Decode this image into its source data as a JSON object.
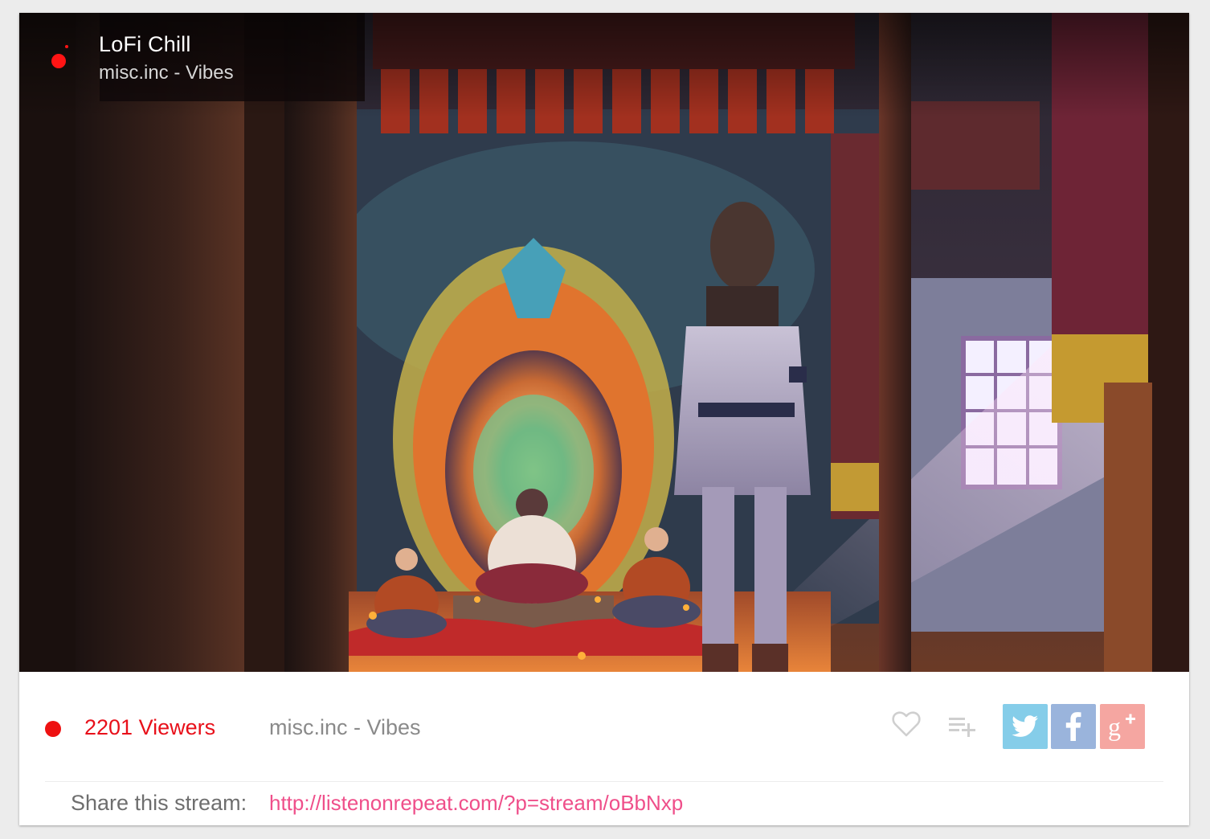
{
  "player": {
    "title": "LoFi Chill",
    "subtitle": "misc.inc - Vibes",
    "thumbnail_icon": "anime-temple-scene-image"
  },
  "info_bar": {
    "viewers": "2201 Viewers",
    "artist": "misc.inc - Vibes",
    "icons": {
      "live": "live-dot-icon",
      "like": "heart-icon",
      "add_to_playlist": "playlist-add-icon"
    },
    "social": [
      {
        "name": "twitter",
        "icon": "twitter-bird-icon",
        "color": "#85cde9"
      },
      {
        "name": "facebook",
        "icon": "facebook-f-icon",
        "color": "#9ab4dc"
      },
      {
        "name": "google-plus",
        "icon": "google-plus-icon",
        "color": "#f5a6a1"
      }
    ]
  },
  "share": {
    "label": "Share this stream:",
    "url": "http://listenonrepeat.com/?p=stream/oBbNxp"
  },
  "colors": {
    "live": "#ee1111",
    "viewers_text": "#e8101a",
    "link": "#ef4f8a",
    "muted_text": "#8a8a8a",
    "background": "#ececec"
  }
}
